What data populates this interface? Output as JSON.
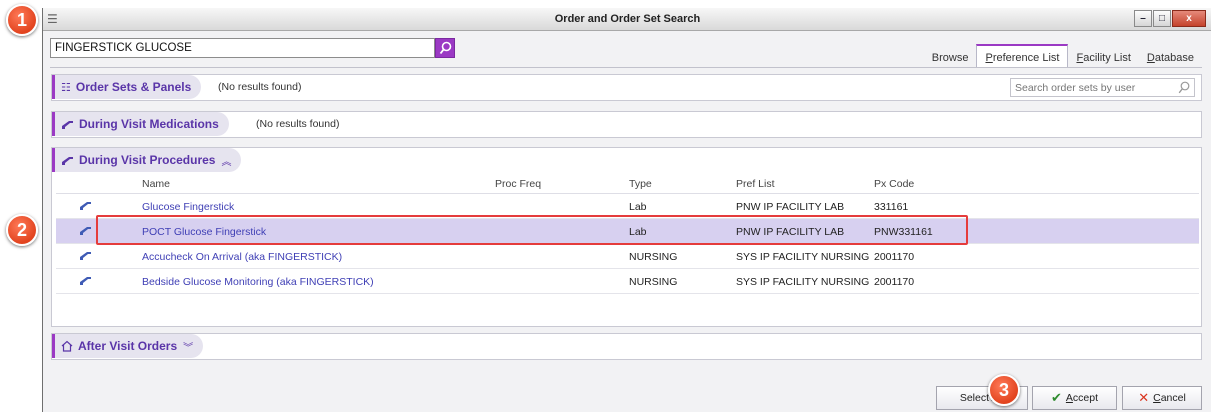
{
  "window": {
    "title": "Order and Order Set Search"
  },
  "search": {
    "value": "FINGERSTICK GLUCOSE"
  },
  "tabs": [
    {
      "label": "Browse",
      "active": false
    },
    {
      "label": "Preference List",
      "active": true,
      "underline": "P",
      "rest": "reference List"
    },
    {
      "label": "Facility List",
      "active": false,
      "underline": "F",
      "rest": "acility List"
    },
    {
      "label": "Database",
      "active": false,
      "underline": "D",
      "rest": "atabase"
    }
  ],
  "sections": {
    "order_sets": {
      "title": "Order Sets & Panels",
      "note": "(No results found)",
      "user_search_placeholder": "Search order sets by user"
    },
    "during_meds": {
      "title": "During Visit Medications",
      "note": "(No results found)"
    },
    "during_procs": {
      "title": "During Visit Procedures",
      "columns": {
        "name": "Name",
        "proc_freq": "Proc Freq",
        "type": "Type",
        "pref_list": "Pref List",
        "px_code": "Px Code"
      },
      "rows": [
        {
          "name": "Glucose Fingerstick",
          "proc_freq": "",
          "type": "Lab",
          "pref_list": "PNW IP FACILITY LAB",
          "px_code": "331161",
          "selected": false
        },
        {
          "name": "POCT Glucose Fingerstick",
          "proc_freq": "",
          "type": "Lab",
          "pref_list": "PNW IP FACILITY LAB",
          "px_code": "PNW331161",
          "selected": true
        },
        {
          "name": "Accucheck On Arrival (aka FINGERSTICK)",
          "proc_freq": "",
          "type": "NURSING",
          "pref_list": "SYS IP FACILITY NURSING",
          "px_code": "2001170",
          "selected": false
        },
        {
          "name": "Bedside Glucose Monitoring (aka FINGERSTICK)",
          "proc_freq": "",
          "type": "NURSING",
          "pref_list": "SYS IP FACILITY NURSING",
          "px_code": "2001170",
          "selected": false
        }
      ]
    },
    "after_visit": {
      "title": "After Visit Orders"
    }
  },
  "buttons": {
    "select_all": "Select An",
    "accept": {
      "underline": "A",
      "rest": "ccept"
    },
    "cancel": {
      "underline": "C",
      "rest": "ancel"
    }
  },
  "annotations": {
    "step1": "1",
    "step2": "2",
    "step3": "3"
  },
  "colors": {
    "accent": "#9b39c4",
    "link": "#3f3fb5",
    "selected_row": "#d7d0f0",
    "badge": "#e2441f",
    "highlight": "#e53c3c"
  }
}
